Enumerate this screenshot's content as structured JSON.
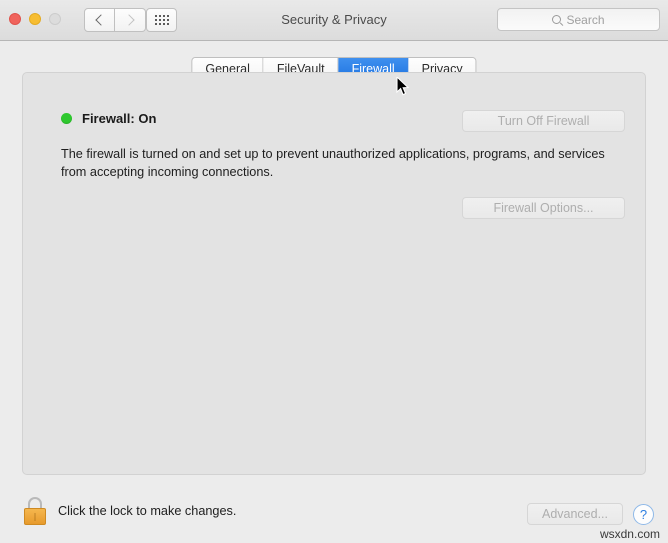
{
  "window": {
    "title": "Security & Privacy",
    "traffic_lights": [
      {
        "name": "close",
        "color": "#f0635c"
      },
      {
        "name": "minimize",
        "color": "#f7bd31"
      },
      {
        "name": "zoom",
        "color": "#dcdcdc"
      }
    ]
  },
  "toolbar": {
    "back_label": "",
    "forward_label": "",
    "show_all_label": "",
    "search": {
      "value": "",
      "placeholder": "Search",
      "icon": "search-icon"
    }
  },
  "tabs": [
    {
      "label": "General",
      "selected": false
    },
    {
      "label": "FileVault",
      "selected": false
    },
    {
      "label": "Firewall",
      "selected": true
    },
    {
      "label": "Privacy",
      "selected": false
    }
  ],
  "firewall": {
    "status_label": "Firewall: On",
    "status_color": "#2ec82e",
    "turn_off_button": "Turn Off Firewall",
    "options_button": "Firewall Options...",
    "description": "The firewall is turned on and set up to prevent unauthorized applications, programs, and services from accepting incoming connections."
  },
  "footer": {
    "lock_text": "Click the lock to make changes.",
    "lock_icon": "lock-closed-icon",
    "advanced_button": "Advanced...",
    "help_button": "?"
  },
  "watermark": "wsxdn.com",
  "colors": {
    "accent_blue": "#1f73e0",
    "status_green": "#2ec82e",
    "lock_gold": "#e79a2c",
    "panel_bg": "#e3e3e3",
    "window_bg": "#ececec"
  }
}
